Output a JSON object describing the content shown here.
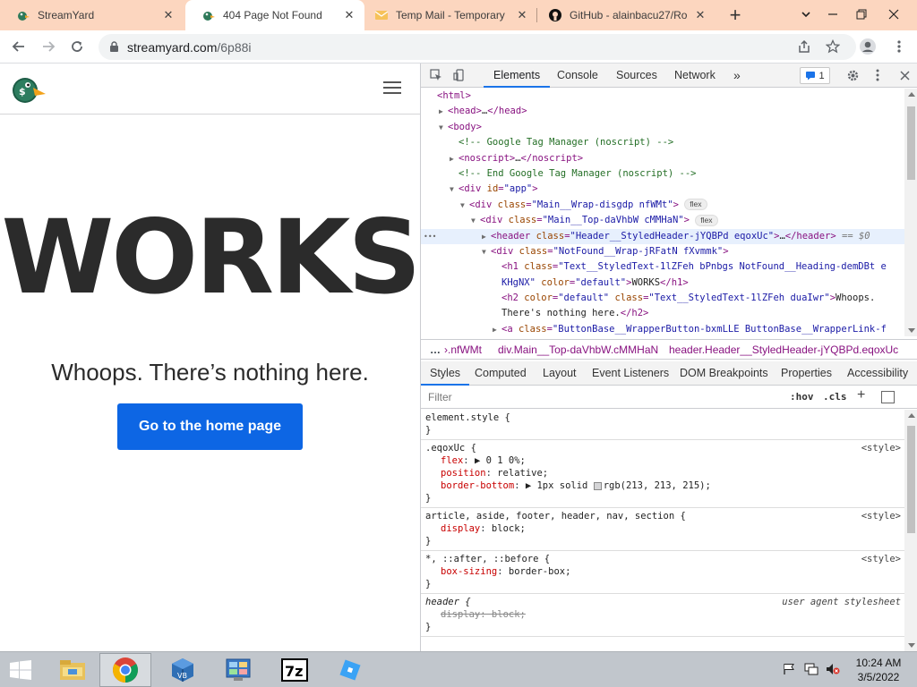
{
  "browser": {
    "tabs": [
      {
        "title": "StreamYard",
        "active": false
      },
      {
        "title": "404 Page Not Found",
        "active": true
      },
      {
        "title": "Temp Mail - Temporary D",
        "active": false
      },
      {
        "title": "GitHub - alainbacu27/Ro",
        "active": false
      }
    ],
    "address": {
      "host": "streamyard.com",
      "path": "/6p88i"
    }
  },
  "page": {
    "heading": "WORKS",
    "subheading": "Whoops. There’s nothing here.",
    "home_button": "Go to the home page"
  },
  "devtools": {
    "tabs": [
      "Elements",
      "Console",
      "Sources",
      "Network"
    ],
    "more": "»",
    "issues_count": "1",
    "dom": [
      {
        "indent": 0,
        "tri": "",
        "html": "<span class='tag'>&lt;html&gt;</span>"
      },
      {
        "indent": 1,
        "tri": "▶",
        "html": "<span class='tag'>&lt;head&gt;</span><span class='txt'>…</span><span class='tag'>&lt;/head&gt;</span>"
      },
      {
        "indent": 1,
        "tri": "▼",
        "html": "<span class='tag'>&lt;body&gt;</span>"
      },
      {
        "indent": 2,
        "tri": "",
        "html": "<span class='cmt'>&lt;!-- Google Tag Manager (noscript) --&gt;</span>"
      },
      {
        "indent": 2,
        "tri": "▶",
        "html": "<span class='tag'>&lt;noscript&gt;</span><span class='txt'>…</span><span class='tag'>&lt;/noscript&gt;</span>"
      },
      {
        "indent": 2,
        "tri": "",
        "html": "<span class='cmt'>&lt;!-- End Google Tag Manager (noscript) --&gt;</span>"
      },
      {
        "indent": 2,
        "tri": "▼",
        "html": "<span class='tag'>&lt;div</span> <span class='attr'>id</span><span class='tag'>=</span><span class='val'>\"app\"</span><span class='tag'>&gt;</span>"
      },
      {
        "indent": 3,
        "tri": "▼",
        "html": "<span class='tag'>&lt;div</span> <span class='attr'>class</span><span class='tag'>=</span><span class='val'>\"Main__Wrap-disgdp nfWMt\"</span><span class='tag'>&gt;</span> <span class='pill'>flex</span>"
      },
      {
        "indent": 4,
        "tri": "▼",
        "html": "<span class='tag'>&lt;div</span> <span class='attr'>class</span><span class='tag'>=</span><span class='val'>\"Main__Top-daVhbW cMMHaN\"</span><span class='tag'>&gt;</span> <span class='pill'>flex</span>"
      },
      {
        "indent": 5,
        "tri": "▶",
        "sel": true,
        "html": "<span class='tag'>&lt;header</span> <span class='attr'>class</span><span class='tag'>=</span><span class='val'>\"Header__StyledHeader-jYQBPd eqoxUc\"</span><span class='tag'>&gt;</span><span class='txt'>…</span><span class='tag'>&lt;/header&gt;</span> <span class='eq'>== $0</span>"
      },
      {
        "indent": 5,
        "tri": "▼",
        "html": "<span class='tag'>&lt;div</span> <span class='attr'>class</span><span class='tag'>=</span><span class='val'>\"NotFound__Wrap-jRFatN fXvmmk\"</span><span class='tag'>&gt;</span>"
      },
      {
        "indent": 6,
        "tri": "",
        "html": "<span class='tag'>&lt;h1</span> <span class='attr'>class</span><span class='tag'>=</span><span class='val'>\"Text__StyledText-1lZFeh bPnbgs NotFound__Heading-demDBt e</span>"
      },
      {
        "indent": 6,
        "tri": "",
        "html": "<span class='val'>KHgNX\"</span> <span class='attr'>color</span><span class='tag'>=</span><span class='val'>\"default\"</span><span class='tag'>&gt;</span><span class='txt'>WORKS</span><span class='tag'>&lt;/h1&gt;</span>"
      },
      {
        "indent": 6,
        "tri": "",
        "html": "<span class='tag'>&lt;h2</span> <span class='attr'>color</span><span class='tag'>=</span><span class='val'>\"default\"</span> <span class='attr'>class</span><span class='tag'>=</span><span class='val'>\"Text__StyledText-1lZFeh duaIwr\"</span><span class='tag'>&gt;</span><span class='txt'>Whoops.</span>"
      },
      {
        "indent": 6,
        "tri": "",
        "html": "<span class='txt'>There's nothing here.</span><span class='tag'>&lt;/h2&gt;</span>"
      },
      {
        "indent": 6,
        "tri": "▶",
        "html": "<span class='tag'>&lt;a</span> <span class='attr'>class</span><span class='tag'>=</span><span class='val'>\"ButtonBase__WrapperButton-bxmLLE ButtonBase__WrapperLink-f</span>"
      }
    ],
    "breadcrumbs": [
      "…",
      "›.nfWMt",
      "div.Main__Top-daVhbW.cMMHaN",
      "header.Header__StyledHeader-jYQBPd.eqoxUc"
    ],
    "style_tabs": [
      "Styles",
      "Computed",
      "Layout",
      "Event Listeners",
      "DOM Breakpoints",
      "Properties",
      "Accessibility"
    ],
    "filter_placeholder": "Filter",
    "hov": ":hov",
    "cls": ".cls",
    "rules": [
      {
        "selector": "element.style {",
        "source": "",
        "props": [],
        "close": "}"
      },
      {
        "selector": ".eqoxUc {",
        "source": "<style>",
        "props": [
          {
            "name": "flex",
            "value": "▶ 0 1 0%;"
          },
          {
            "name": "position",
            "value": "relative;"
          },
          {
            "name": "border-bottom",
            "value": "▶ 1px solid ",
            "swatch": true,
            "value2": "rgb(213, 213, 215);"
          }
        ],
        "close": "}"
      },
      {
        "selector": "article, aside, footer, header, nav, section {",
        "source": "<style>",
        "props": [
          {
            "name": "display",
            "value": "block;"
          }
        ],
        "close": "}"
      },
      {
        "selector": "*, ::after, ::before {",
        "source": "<style>",
        "props": [
          {
            "name": "box-sizing",
            "value": "border-box;"
          }
        ],
        "close": "}"
      },
      {
        "selector": "header {",
        "source": "user agent stylesheet",
        "ua": true,
        "props": [
          {
            "name": "display",
            "value": "block;",
            "struck": true
          }
        ],
        "close": "}"
      }
    ]
  },
  "taskbar": {
    "apps": [
      "file-explorer",
      "chrome",
      "virtualbox",
      "control-panel",
      "7-zip",
      "roblox-studio"
    ],
    "time": "10:24 AM",
    "date": "3/5/2022"
  },
  "colors": {
    "tab_strip": "#fcd6bf",
    "home_button": "#0d66e4",
    "devtools_accent": "#1a73e8"
  }
}
